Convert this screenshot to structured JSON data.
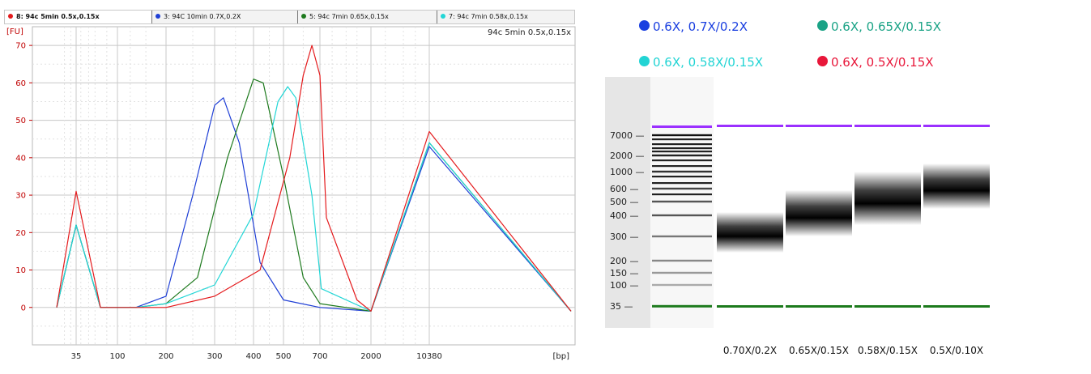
{
  "tabs": [
    {
      "label": "8: 94c 5min 0.5x,0.15x",
      "color": "#e41a1c",
      "active": true
    },
    {
      "label": "3: 94C 10min 0.7X,0.2X",
      "color": "#1f3fd6",
      "active": false
    },
    {
      "label": "5: 94c 7min 0.65x,0.15x",
      "color": "#1e7a1e",
      "active": false
    },
    {
      "label": "7: 94c 7min 0.58x,0.15x",
      "color": "#22d6d6",
      "active": false
    }
  ],
  "electropherogram": {
    "sample_title": "94c 5min 0.5x,0.15x",
    "ylabel": "[FU]",
    "xlabel": "[bp]",
    "y_ticks": [
      "0",
      "10",
      "20",
      "30",
      "40",
      "50",
      "60",
      "70"
    ],
    "x_ticks": [
      "35",
      "100",
      "200",
      "300",
      "400",
      "500",
      "700",
      "2000",
      "10380"
    ]
  },
  "chart_data": {
    "type": "line",
    "title": "94c 5min 0.5x,0.15x",
    "xlabel": "[bp]",
    "ylabel": "[FU]",
    "ylim": [
      -10,
      75
    ],
    "x_scale": "sizing ladder (marker peaks at 35 and 10380 bp)",
    "x_tick_labels": [
      "35",
      "100",
      "200",
      "300",
      "400",
      "500",
      "700",
      "2000",
      "10380"
    ],
    "grid": true,
    "series": [
      {
        "name": "3: 94C 10min 0.7X,0.2X",
        "color": "#1f3fd6",
        "x": [
          20,
          35,
          70,
          130,
          200,
          250,
          300,
          320,
          360,
          420,
          500,
          700,
          2000,
          10380,
          15000
        ],
        "y": [
          0,
          22,
          0,
          0,
          3,
          30,
          54,
          56,
          44,
          12,
          2,
          0,
          -1,
          43,
          -1
        ]
      },
      {
        "name": "5: 94c 7min 0.65x,0.15x",
        "color": "#1e7a1e",
        "x": [
          20,
          35,
          70,
          130,
          200,
          260,
          330,
          400,
          430,
          500,
          600,
          700,
          2000,
          10380,
          15000
        ],
        "y": [
          0,
          22,
          0,
          0,
          1,
          8,
          40,
          61,
          60,
          35,
          8,
          1,
          -1,
          44,
          -1
        ]
      },
      {
        "name": "7: 94c 7min 0.58x,0.15x",
        "color": "#22d6d6",
        "x": [
          20,
          35,
          70,
          130,
          200,
          300,
          400,
          480,
          520,
          560,
          650,
          720,
          2000,
          10380,
          15000
        ],
        "y": [
          0,
          22,
          0,
          0,
          1,
          6,
          25,
          55,
          59,
          56,
          30,
          5,
          -1,
          44,
          -1
        ]
      },
      {
        "name": "8: 94c 5min 0.5x,0.15x",
        "color": "#e41a1c",
        "x": [
          20,
          35,
          70,
          130,
          200,
          300,
          420,
          530,
          600,
          650,
          700,
          800,
          1500,
          2000,
          10380,
          15000
        ],
        "y": [
          0,
          31,
          0,
          0,
          0,
          3,
          10,
          40,
          62,
          70,
          62,
          24,
          2,
          -1,
          47,
          -1
        ]
      }
    ]
  },
  "gel": {
    "legend": [
      {
        "label": "0.6X, 0.7X/0.2X",
        "color": "#1a3fe0"
      },
      {
        "label": "0.6X, 0.65X/0.15X",
        "color": "#1ba386"
      },
      {
        "label": "0.6X, 0.58X/0.15X",
        "color": "#22d4d4"
      },
      {
        "label": "0.6X, 0.5X/0.15X",
        "color": "#e8173a"
      }
    ],
    "ladder_labels": [
      "7000",
      "2000",
      "1000",
      "600",
      "500",
      "400",
      "300",
      "200",
      "150",
      "100",
      "35"
    ],
    "lane_labels": [
      "0.70X/0.2X",
      "0.65X/0.15X",
      "0.58X/0.15X",
      "0.5X/0.10X"
    ],
    "upper_marker_color": "#9b30ff",
    "lower_marker_color": "#1c7a1c"
  }
}
